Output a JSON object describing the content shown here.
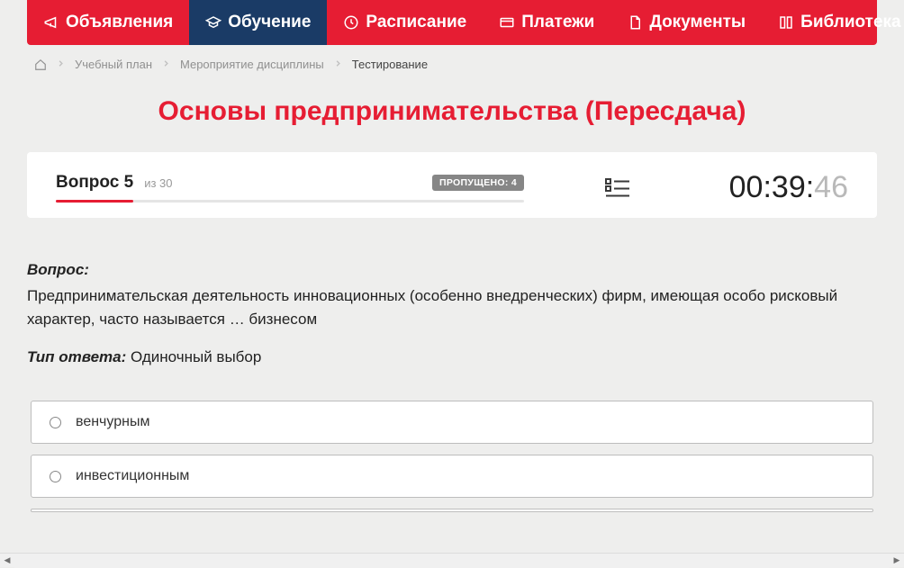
{
  "nav": {
    "items": [
      {
        "label": "Объявления",
        "icon": "megaphone-icon"
      },
      {
        "label": "Обучение",
        "icon": "education-icon"
      },
      {
        "label": "Расписание",
        "icon": "clock-icon"
      },
      {
        "label": "Платежи",
        "icon": "payment-icon"
      },
      {
        "label": "Документы",
        "icon": "document-icon"
      },
      {
        "label": "Библиотека",
        "icon": "library-icon"
      }
    ]
  },
  "breadcrumb": {
    "items": [
      "Учебный план",
      "Мероприятие дисциплины"
    ],
    "current": "Тестирование"
  },
  "page_title": "Основы предпринимательства (Пересдача)",
  "status": {
    "question_label": "Вопрос 5",
    "question_total": "из 30",
    "skipped_label": "ПРОПУЩЕНО: 4",
    "timer_main": "00:39:",
    "timer_sec": "46"
  },
  "question": {
    "label": "Вопрос:",
    "text": "Предпринимательская деятельность инновационных (особенно внедренческих) фирм, имеющая особо рисковый характер, часто называется … бизнесом"
  },
  "answer_type": {
    "label": "Тип ответа:",
    "value": "Одиночный выбор"
  },
  "answers": [
    "венчурным",
    "инвестиционным"
  ]
}
